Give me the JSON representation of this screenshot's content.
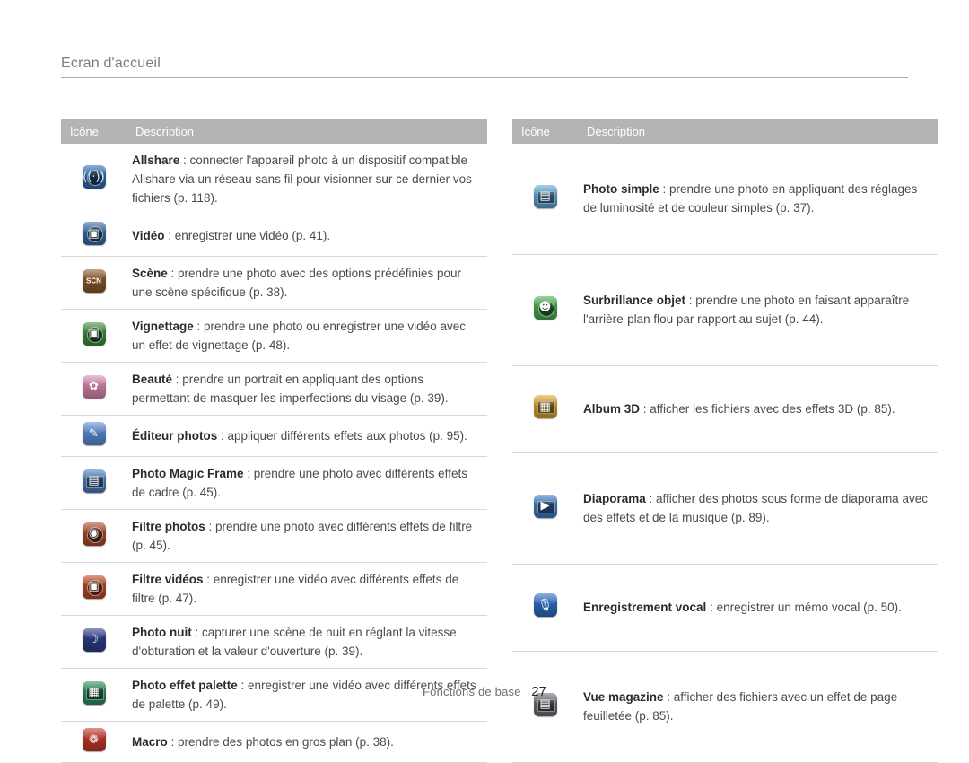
{
  "header": {
    "title": "Ecran d'accueil"
  },
  "columns": {
    "icon": "Icône",
    "description": "Description"
  },
  "left_table": {
    "rows": [
      {
        "icon": "allshare-icon",
        "icon_bg": "#2d6fb5",
        "icon_fg": "#dbe9f7",
        "glyph": "((·))",
        "style": "circle",
        "bold": "Allshare",
        "text": " : connecter l'appareil photo à un dispositif compatible Allshare via un réseau sans fil pour visionner sur ce dernier vos fichiers (p. 118)."
      },
      {
        "icon": "video-icon",
        "icon_bg": "#3b6ea8",
        "icon_fg": "#ffffff",
        "glyph": "▣",
        "style": "circle",
        "bold": "Vidéo",
        "text": " : enregistrer une vidéo (p. 41)."
      },
      {
        "icon": "scene-icon",
        "icon_bg": "#8c5a2b",
        "icon_fg": "#ffffff",
        "glyph": "SCN",
        "style": "text",
        "bold": "Scène",
        "text": " : prendre une photo avec des options prédéfinies pour une scène spécifique (p. 38)."
      },
      {
        "icon": "vignette-icon",
        "icon_bg": "#3f8f3f",
        "icon_fg": "#ffffff",
        "glyph": "▣",
        "style": "circle",
        "bold": "Vignettage",
        "text": " : prendre une photo ou enregistrer une vidéo avec un effet de vignettage (p. 48)."
      },
      {
        "icon": "beauty-icon",
        "icon_bg": "#d98ab0",
        "icon_fg": "#ffffff",
        "glyph": "✿",
        "style": "plain",
        "bold": "Beauté",
        "text": " : prendre un portrait en appliquant des options permettant de masquer les imperfections du visage (p. 39)."
      },
      {
        "icon": "photo-editor-icon",
        "icon_bg": "#5c8fd6",
        "icon_fg": "#ffffff",
        "glyph": "✎",
        "style": "plain",
        "bold": "Éditeur photos",
        "text": " : appliquer différents effets aux photos (p. 95)."
      },
      {
        "icon": "magic-frame-icon",
        "icon_bg": "#4d7fc4",
        "icon_fg": "#ffffff",
        "glyph": "▤",
        "style": "rect",
        "bold": "Photo Magic Frame",
        "text": " : prendre une photo avec différents effets de cadre (p. 45)."
      },
      {
        "icon": "photo-filter-icon",
        "icon_bg": "#b04a2e",
        "icon_fg": "#ffffff",
        "glyph": "◉",
        "style": "circle",
        "bold": "Filtre photos",
        "text": " : prendre une photo avec différents effets de filtre (p. 45)."
      },
      {
        "icon": "video-filter-icon",
        "icon_bg": "#c2471f",
        "icon_fg": "#ffffff",
        "glyph": "▣",
        "style": "circle",
        "bold": "Filtre vidéos",
        "text": " : enregistrer une vidéo avec différents effets de filtre (p. 47)."
      },
      {
        "icon": "night-photo-icon",
        "icon_bg": "#2f3f8c",
        "icon_fg": "#ffffff",
        "glyph": "☽",
        "style": "plain",
        "bold": "Photo nuit",
        "text": " : capturer une scène de nuit en réglant la vitesse d'obturation et la valeur d'ouverture (p. 39)."
      },
      {
        "icon": "palette-effect-icon",
        "icon_bg": "#2f8f5f",
        "icon_fg": "#ffffff",
        "glyph": "▦",
        "style": "rect",
        "bold": "Photo effet palette",
        "text": " : enregistrer une vidéo avec différents effets de palette (p. 49)."
      },
      {
        "icon": "macro-icon",
        "icon_bg": "#c43a2a",
        "icon_fg": "#ffffff",
        "glyph": "❁",
        "style": "plain",
        "bold": "Macro",
        "text": " : prendre des photos en gros plan (p. 38)."
      }
    ]
  },
  "right_table": {
    "rows": [
      {
        "icon": "simple-photo-icon",
        "icon_bg": "#5aa7d8",
        "icon_fg": "#ffffff",
        "glyph": "▤",
        "style": "rect",
        "bold": "Photo simple",
        "text": " : prendre une photo en appliquant des réglages de luminosité et de couleur simples (p. 37)."
      },
      {
        "icon": "object-highlight-icon",
        "icon_bg": "#4caf50",
        "icon_fg": "#ffffff",
        "glyph": "☻",
        "style": "circle",
        "bold": "Surbrillance objet",
        "text": " : prendre une photo en faisant apparaître l'arrière-plan flou par rapport au sujet (p. 44)."
      },
      {
        "icon": "album-3d-icon",
        "icon_bg": "#d9a32b",
        "icon_fg": "#ffffff",
        "glyph": "▦",
        "style": "rect",
        "bold": "Album 3D",
        "text": " : afficher les fichiers avec des effets 3D (p. 85)."
      },
      {
        "icon": "slideshow-icon",
        "icon_bg": "#3f7fc4",
        "icon_fg": "#ffffff",
        "glyph": "▶",
        "style": "rect",
        "bold": "Diaporama",
        "text": " : afficher des photos sous forme de diaporama avec des effets et de la musique (p. 89)."
      },
      {
        "icon": "voice-recorder-icon",
        "icon_bg": "#2f6fc4",
        "icon_fg": "#ffffff",
        "glyph": "🎙",
        "style": "plain",
        "bold": "Enregistrement vocal",
        "text": " : enregistrer un mémo vocal (p. 50)."
      },
      {
        "icon": "magazine-view-icon",
        "icon_bg": "#6a6f77",
        "icon_fg": "#ffffff",
        "glyph": "▤",
        "style": "rect",
        "bold": "Vue magazine",
        "text": " : afficher des fichiers avec un effet de page feuilletée (p. 85)."
      }
    ]
  },
  "footer": {
    "label": "Fonctions de base",
    "page": "27"
  }
}
